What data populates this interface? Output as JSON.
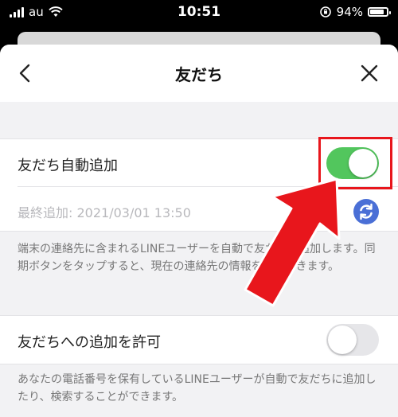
{
  "status_bar": {
    "carrier": "au",
    "time": "10:51",
    "battery_percent": "94%",
    "battery_level": 0.94
  },
  "navbar": {
    "title": "友だち",
    "back_icon": "chevron-left-icon",
    "close_icon": "close-icon"
  },
  "auto_add": {
    "label": "友だち自動追加",
    "enabled": true,
    "last_added": "最終追加: 2021/03/01 13:50",
    "sync_icon": "sync-icon",
    "description": "端末の連絡先に含まれるLINEユーザーを自動で友だちに追加します。同期ボタンをタップすると、現在の連絡先の情報を同期できます。"
  },
  "allow_add": {
    "label": "友だちへの追加を許可",
    "enabled": false,
    "description": "あなたの電話番号を保有しているLINEユーザーが自動で友だちに追加したり、検索することができます。"
  },
  "colors": {
    "toggle_on": "#52c65d",
    "toggle_off": "#e6e6e9",
    "sync_button": "#4a6fd6",
    "annotation_red": "#e8161c"
  }
}
